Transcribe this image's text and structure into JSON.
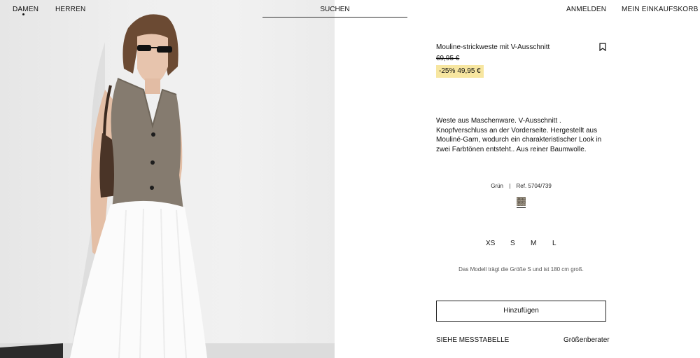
{
  "nav": {
    "women": "DAMEN",
    "men": "HERREN",
    "search": "SUCHEN",
    "login": "ANMELDEN",
    "cart": "MEIN EINKAUFSKORB"
  },
  "product": {
    "title": "Mouline-strickweste mit V-Ausschnitt",
    "old_price": "69,95 €",
    "discount": "-25%",
    "sale_price": "49,95 €",
    "description": "Weste aus Maschenware. V-Ausschnitt . Knopfverschluss an der Vorderseite. Hergestellt aus Mouliné-Garn, wodurch ein charakteristischer Look in zwei Farbtönen entsteht.. Aus reiner Baumwolle.",
    "color": "Grün",
    "separator": "|",
    "ref": "Ref. 5704/739",
    "sizes": [
      "XS",
      "S",
      "M",
      "L"
    ],
    "model_note": "Das Modell trägt die Größe S und ist 180 cm groß.",
    "add_button": "Hinzufügen",
    "size_chart": "SIEHE MESSTABELLE",
    "size_advisor": "Größenberater"
  },
  "colors": {
    "sale_highlight": "#f7e6a0",
    "text": "#111111"
  },
  "icons": {
    "bookmark": "bookmark-icon",
    "active_nav": "dot-indicator"
  }
}
